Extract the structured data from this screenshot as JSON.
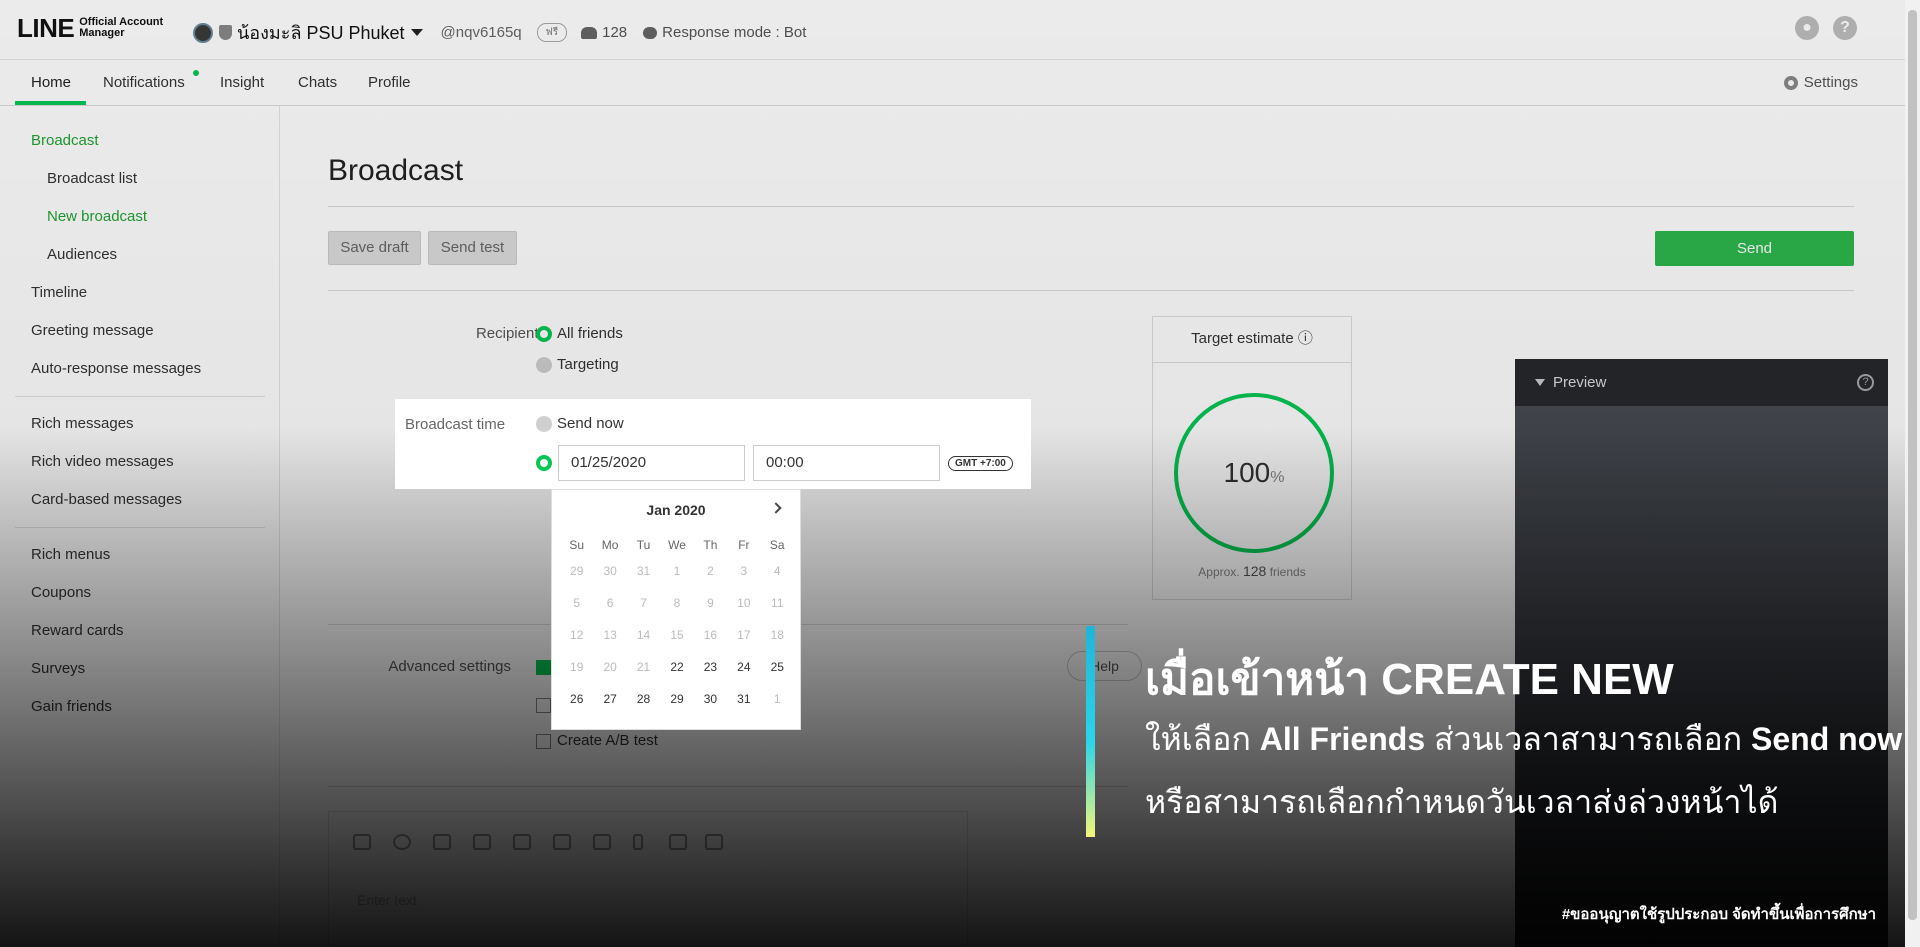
{
  "header": {
    "logo_text": "LINE",
    "logo_sub_1": "Official Account",
    "logo_sub_2": "Manager",
    "account_name": "น้องมะลิ PSU Phuket",
    "account_id": "@nqv6165q",
    "plan_badge": "ฟรี",
    "friends_count": "128",
    "response_mode": "Response mode : Bot",
    "icons": [
      "account-icon",
      "help-icon"
    ]
  },
  "nav": {
    "tabs": [
      "Home",
      "Notifications",
      "Insight",
      "Chats",
      "Profile"
    ],
    "settings_label": "Settings"
  },
  "sidebar": {
    "items": [
      "Broadcast",
      "Broadcast list",
      "New broadcast",
      "Audiences",
      "Timeline",
      "Greeting message",
      "Auto-response messages",
      "Rich messages",
      "Rich video messages",
      "Card-based messages",
      "Rich menus",
      "Coupons",
      "Reward cards",
      "Surveys",
      "Gain friends"
    ]
  },
  "main": {
    "title": "Broadcast",
    "save_draft": "Save draft",
    "send_test": "Send test",
    "send": "Send",
    "recipients_label": "Recipients",
    "recipients_opt1": "All friends",
    "recipients_opt2": "Targeting",
    "broadcast_time_label": "Broadcast time",
    "send_now": "Send now",
    "date_value": "01/25/2020",
    "time_value": "00:00",
    "timezone": "GMT +7:00",
    "target_title": "Target estimate",
    "target_percent": "100",
    "target_percent_unit": "%",
    "approx_prefix": "Approx.",
    "approx_count": "128",
    "approx_suffix": "friends",
    "advanced_label": "Advanced settings",
    "ab_test": "Create A/B test",
    "help": "Help",
    "editor_placeholder": "Enter text"
  },
  "calendar": {
    "month": "Jan 2020",
    "dow": [
      "Su",
      "Mo",
      "Tu",
      "We",
      "Th",
      "Fr",
      "Sa"
    ],
    "days": [
      "29",
      "30",
      "31",
      "1",
      "2",
      "3",
      "4",
      "5",
      "6",
      "7",
      "8",
      "9",
      "10",
      "11",
      "12",
      "13",
      "14",
      "15",
      "16",
      "17",
      "18",
      "19",
      "20",
      "21",
      "22",
      "23",
      "24",
      "25",
      "26",
      "27",
      "28",
      "29",
      "30",
      "31",
      "1"
    ]
  },
  "preview": {
    "title": "Preview"
  },
  "caption": {
    "line1": "เมื่อเข้าหน้า CREATE NEW",
    "line2_a": "ให้เลือก ",
    "line2_b": "All Friends",
    "line2_c": " ส่วนเวลาสามารถเลือก ",
    "line2_d": "Send now",
    "line3": "หรือสามารถเลือกกำหนดวันเวลาส่งล่วงหน้าได้",
    "credit": "#ขออนุญาตใช้รูปประกอบ จัดทำขึ้นเพื่อการศึกษา"
  },
  "colors": {
    "accent": "#06c755",
    "send_button": "#2db84d"
  }
}
